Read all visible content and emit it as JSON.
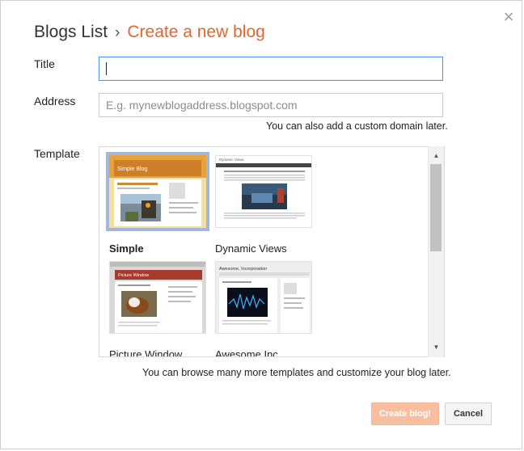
{
  "dialog": {
    "close_glyph": "×",
    "breadcrumb": {
      "root": "Blogs List",
      "separator": "›",
      "current": "Create a new blog"
    },
    "title_field": {
      "label": "Title",
      "value": ""
    },
    "address_field": {
      "label": "Address",
      "placeholder": "E.g. mynewblogaddress.blogspot.com",
      "hint": "You can also add a custom domain later."
    },
    "template_field": {
      "label": "Template",
      "templates": [
        {
          "name": "Simple",
          "selected": true
        },
        {
          "name": "Dynamic Views",
          "selected": false
        },
        {
          "name": "Picture Window",
          "selected": false
        },
        {
          "name": "Awesome Inc.",
          "selected": false
        }
      ],
      "hint": "You can browse many more templates and customize your blog later."
    },
    "thumbnails": {
      "simple_banner_text": "Simple Blog",
      "dynamic_header_text": "Dynamic Views",
      "picture_window_banner_text": "Picture Window",
      "awesome_header_text": "Awesome, Incorporation"
    },
    "buttons": {
      "create": "Create blog!",
      "cancel": "Cancel"
    }
  },
  "colors": {
    "accent": "#e8642d",
    "focus_border": "#4d90fe",
    "selected_border": "#a3b8d8",
    "create_button_disabled": "#f7bfa0"
  }
}
